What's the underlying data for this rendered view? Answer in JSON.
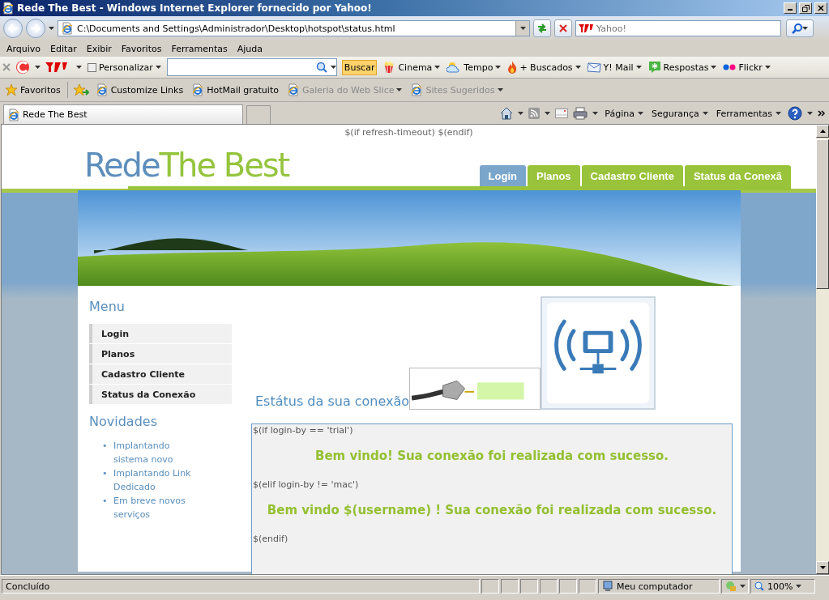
{
  "window": {
    "title": "Rede The Best - Windows Internet Explorer fornecido por Yahoo!"
  },
  "address_bar": {
    "value": "C:\\Documents and Settings\\Administrador\\Desktop\\hotspot\\status.html"
  },
  "search": {
    "placeholder": "Yahoo!"
  },
  "menu_bar": [
    "Arquivo",
    "Editar",
    "Exibir",
    "Favoritos",
    "Ferramentas",
    "Ajuda"
  ],
  "yahoo_toolbar": {
    "customize": "Personalizar",
    "search_button": "Buscar",
    "items": [
      {
        "label": "Cinema",
        "kind": "cinema"
      },
      {
        "label": "Tempo",
        "kind": "weather"
      },
      {
        "label": "+ Buscados",
        "kind": "flame"
      },
      {
        "label": "Y! Mail",
        "kind": "mail"
      },
      {
        "label": "Respostas",
        "kind": "answers"
      },
      {
        "label": "Flickr",
        "kind": "dots"
      }
    ]
  },
  "favorites_bar": {
    "favorites": "Favoritos",
    "links": [
      {
        "label": "Customize Links",
        "disabled": false,
        "has_menu": false
      },
      {
        "label": "HotMail gratuito",
        "disabled": false,
        "has_menu": false
      },
      {
        "label": "Galeria do Web Slice",
        "disabled": true,
        "has_menu": true
      },
      {
        "label": "Sites Sugeridos",
        "disabled": true,
        "has_menu": true
      }
    ]
  },
  "tab": {
    "title": "Rede The Best"
  },
  "command_bar": [
    "Página",
    "Segurança",
    "Ferramentas"
  ],
  "page": {
    "top_note": "$(if refresh-timeout) $(endif)",
    "logo": {
      "first": "Rede",
      "second": "The Best"
    },
    "nav": [
      {
        "label": "Login",
        "selected": true
      },
      {
        "label": "Planos",
        "selected": false
      },
      {
        "label": "Cadastro Cliente",
        "selected": false
      },
      {
        "label": "Status da Conexã",
        "selected": false
      }
    ],
    "menu_title": "Menu",
    "menu": [
      "Login",
      "Planos",
      "Cadastro Cliente",
      "Status da Conexão"
    ],
    "news_title": "Novidades",
    "news": [
      {
        "bullet": "•",
        "text": "Implantando sistema novo"
      },
      {
        "bullet": "•",
        "text": "Implantando Link Dedicado"
      },
      {
        "bullet": "•",
        "text": "Em breve novos serviços"
      }
    ],
    "status_heading": "Estátus da sua conexão",
    "status_lines": [
      {
        "kind": "code",
        "text": "$(if login-by == 'trial')"
      },
      {
        "kind": "message",
        "text": "Bem vindo! Sua conexão foi realizada com sucesso."
      },
      {
        "kind": "code",
        "text": "$(elif login-by != 'mac')"
      },
      {
        "kind": "message",
        "text": "Bem vindo $(username) ! Sua conexão foi realizada com sucesso."
      },
      {
        "kind": "code",
        "text": "$(endif)"
      }
    ]
  },
  "status_bar": {
    "text": "Concluído",
    "zone": "Meu computador",
    "zoom": "100%"
  }
}
